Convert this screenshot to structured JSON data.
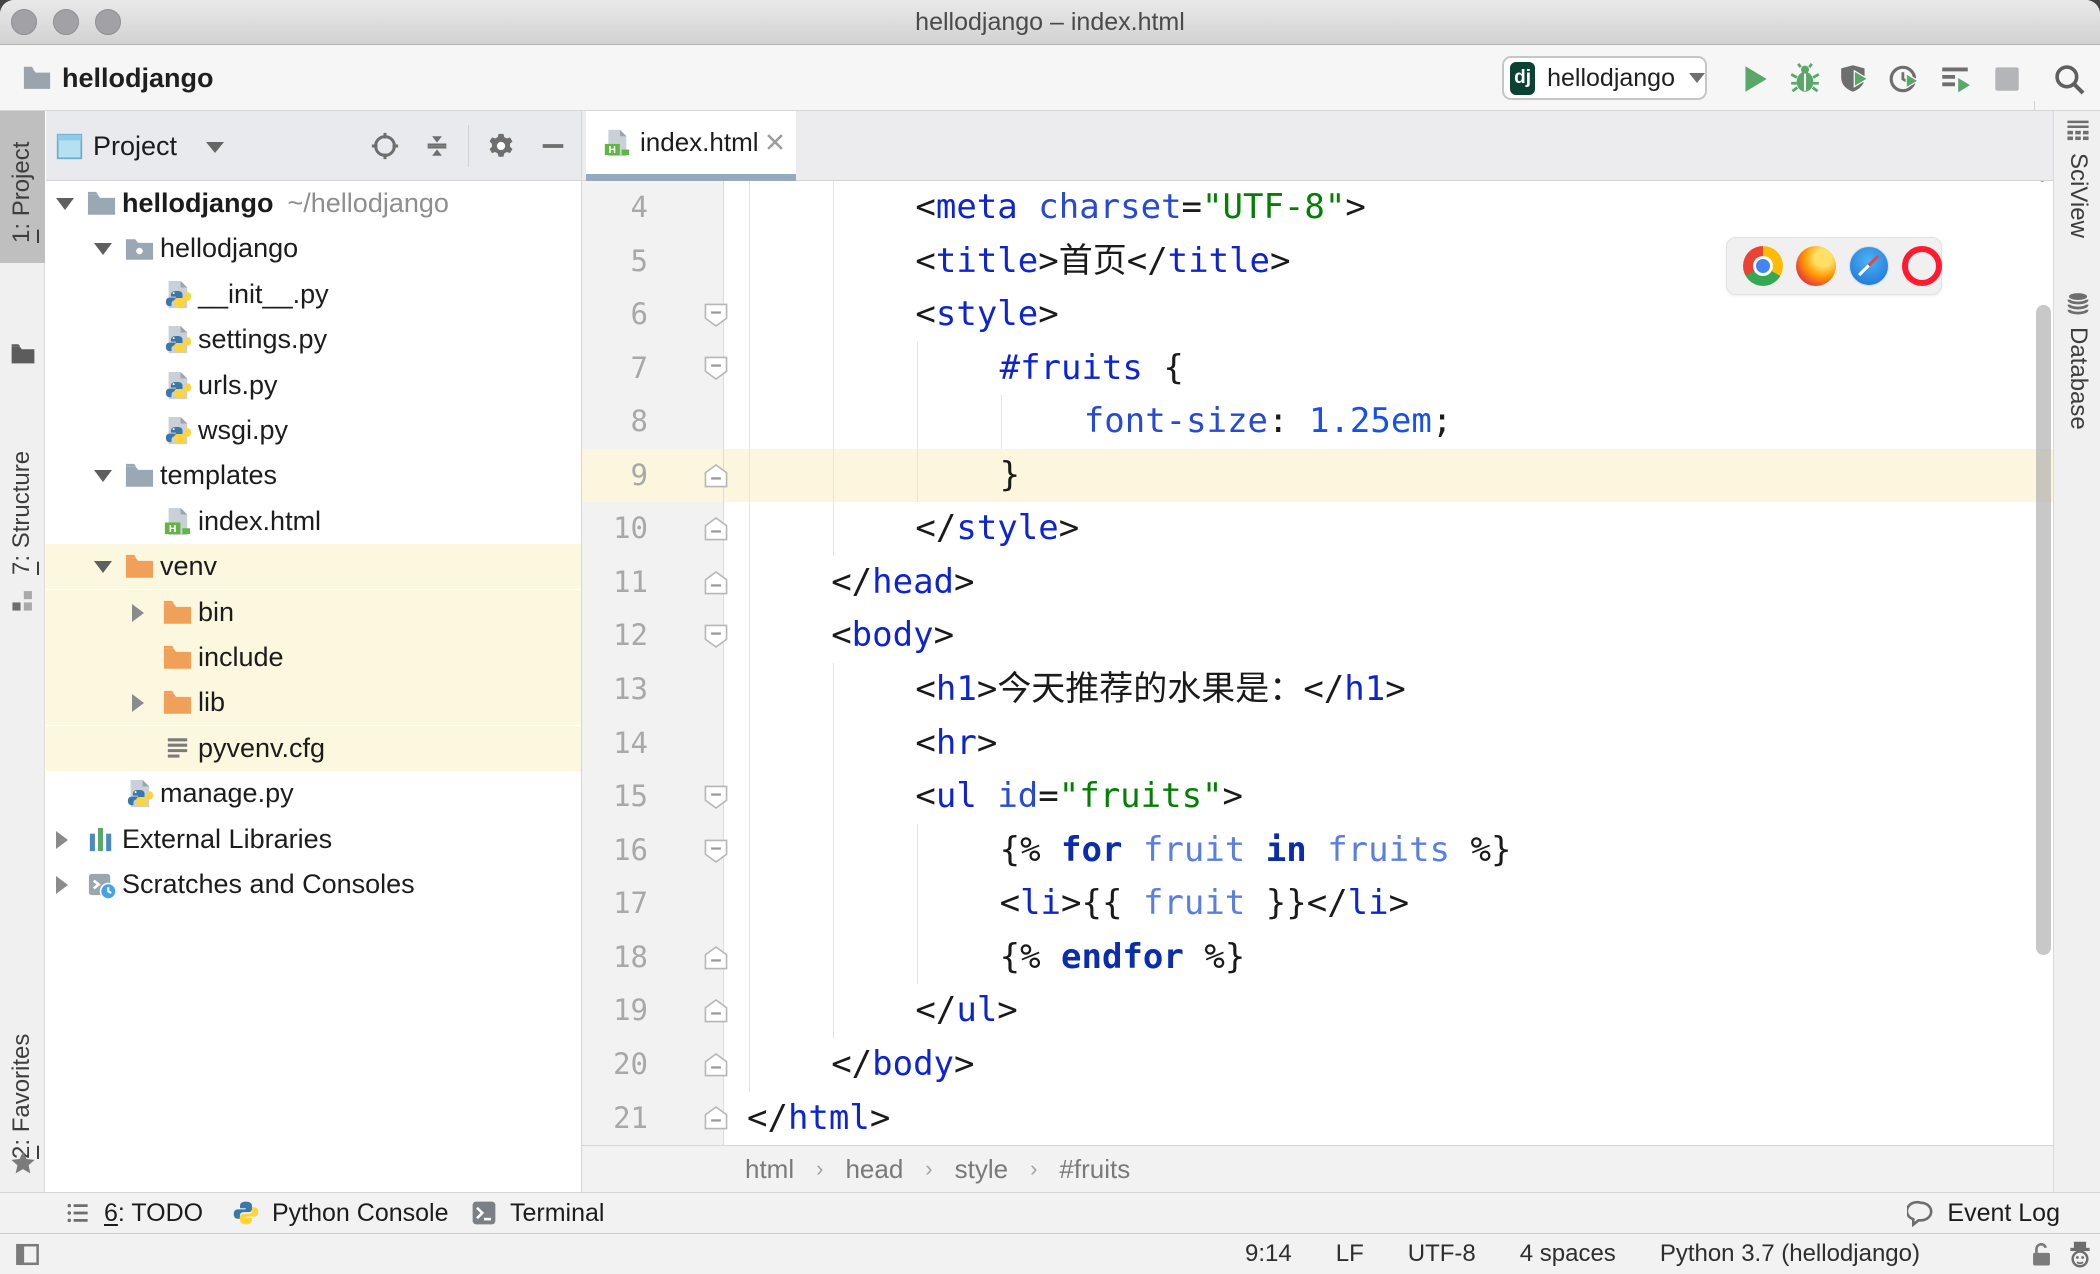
{
  "window": {
    "title": "hellodjango – index.html"
  },
  "navbar": {
    "crumb": "hellodjango",
    "run_config": {
      "badge": "dj",
      "name": "hellodjango"
    },
    "buttons": [
      "run",
      "debug",
      "run-coverage",
      "profile",
      "run-concurrency",
      "stop",
      "search"
    ]
  },
  "left_bar": {
    "items": [
      {
        "label": "1: Project",
        "icon": "project-folder",
        "active": true
      },
      {
        "label": "7: Structure",
        "icon": "structure"
      },
      {
        "label": "2: Favorites",
        "icon": "star"
      }
    ]
  },
  "right_bar": {
    "items": [
      {
        "label": "SciView",
        "icon": "sciview"
      },
      {
        "label": "Database",
        "icon": "database"
      }
    ]
  },
  "project_panel": {
    "title": "Project",
    "tree": [
      {
        "label": "hellodjango",
        "extra": "~/hellodjango",
        "level": 0,
        "arrow": "open",
        "icon": "folder",
        "bold": true
      },
      {
        "label": "hellodjango",
        "level": 1,
        "arrow": "open",
        "icon": "folder-pkg"
      },
      {
        "label": "__init__.py",
        "level": 2,
        "icon": "py"
      },
      {
        "label": "settings.py",
        "level": 2,
        "icon": "py"
      },
      {
        "label": "urls.py",
        "level": 2,
        "icon": "py"
      },
      {
        "label": "wsgi.py",
        "level": 2,
        "icon": "py"
      },
      {
        "label": "templates",
        "level": 1,
        "arrow": "open",
        "icon": "folder"
      },
      {
        "label": "index.html",
        "level": 2,
        "icon": "html"
      },
      {
        "label": "venv",
        "level": 1,
        "arrow": "open",
        "icon": "folder-x",
        "hl": true
      },
      {
        "label": "bin",
        "level": 2,
        "arrow": "closed",
        "icon": "folder-x",
        "hl": true
      },
      {
        "label": "include",
        "level": 2,
        "icon": "folder-x",
        "hl": true
      },
      {
        "label": "lib",
        "level": 2,
        "arrow": "closed",
        "icon": "folder-x",
        "hl": true
      },
      {
        "label": "pyvenv.cfg",
        "level": 2,
        "icon": "cfg",
        "hl": true
      },
      {
        "label": "manage.py",
        "level": 1,
        "icon": "py"
      },
      {
        "label": "External Libraries",
        "level": 0,
        "arrow": "closed",
        "icon": "libs"
      },
      {
        "label": "Scratches and Consoles",
        "level": 0,
        "arrow": "closed",
        "icon": "scratches"
      }
    ]
  },
  "editor": {
    "tab": {
      "label": "index.html"
    },
    "caret_line": 9,
    "browsers": [
      "chrome",
      "firefox",
      "safari",
      "opera"
    ],
    "breadcrumbs": [
      "html",
      "head",
      "style",
      "#fruits"
    ],
    "lines": [
      {
        "num": 4,
        "cols": 8,
        "fold": null,
        "seg": [
          [
            "p",
            "<"
          ],
          [
            "tag",
            "meta"
          ],
          [
            "t",
            " "
          ],
          [
            "attr",
            "charset"
          ],
          [
            "p",
            "="
          ],
          [
            "str",
            "\"UTF-8\""
          ],
          [
            "p",
            ">"
          ]
        ]
      },
      {
        "num": 5,
        "cols": 8,
        "fold": null,
        "seg": [
          [
            "p",
            "<"
          ],
          [
            "tag",
            "title"
          ],
          [
            "p",
            ">"
          ],
          [
            "t",
            "首页"
          ],
          [
            "p",
            "</"
          ],
          [
            "tag",
            "title"
          ],
          [
            "p",
            ">"
          ]
        ]
      },
      {
        "num": 6,
        "cols": 8,
        "fold": "start",
        "seg": [
          [
            "p",
            "<"
          ],
          [
            "tag",
            "style"
          ],
          [
            "p",
            ">"
          ]
        ]
      },
      {
        "num": 7,
        "cols": 12,
        "fold": "start",
        "seg": [
          [
            "sel",
            "#fruits"
          ],
          [
            "t",
            " {"
          ]
        ]
      },
      {
        "num": 8,
        "cols": 16,
        "fold": null,
        "seg": [
          [
            "attr",
            "font-size"
          ],
          [
            "t",
            ": "
          ],
          [
            "num",
            "1.25em"
          ],
          [
            "t",
            ";"
          ]
        ]
      },
      {
        "num": 9,
        "cols": 12,
        "fold": "end",
        "seg": [
          [
            "t",
            "}"
          ]
        ]
      },
      {
        "num": 10,
        "cols": 8,
        "fold": "end",
        "seg": [
          [
            "p",
            "</"
          ],
          [
            "tag",
            "style"
          ],
          [
            "p",
            ">"
          ]
        ]
      },
      {
        "num": 11,
        "cols": 4,
        "fold": "end",
        "seg": [
          [
            "p",
            "</"
          ],
          [
            "tag",
            "head"
          ],
          [
            "p",
            ">"
          ]
        ]
      },
      {
        "num": 12,
        "cols": 4,
        "fold": "start",
        "seg": [
          [
            "p",
            "<"
          ],
          [
            "tag",
            "body"
          ],
          [
            "p",
            ">"
          ]
        ]
      },
      {
        "num": 13,
        "cols": 8,
        "fold": null,
        "seg": [
          [
            "p",
            "<"
          ],
          [
            "tag",
            "h1"
          ],
          [
            "p",
            ">"
          ],
          [
            "t",
            "今天推荐的水果是："
          ],
          [
            "p",
            "</"
          ],
          [
            "tag",
            "h1"
          ],
          [
            "p",
            ">"
          ]
        ]
      },
      {
        "num": 14,
        "cols": 8,
        "fold": null,
        "seg": [
          [
            "p",
            "<"
          ],
          [
            "tag",
            "hr"
          ],
          [
            "p",
            ">"
          ]
        ]
      },
      {
        "num": 15,
        "cols": 8,
        "fold": "start",
        "seg": [
          [
            "p",
            "<"
          ],
          [
            "tag",
            "ul"
          ],
          [
            "t",
            " "
          ],
          [
            "attr",
            "id"
          ],
          [
            "p",
            "="
          ],
          [
            "str",
            "\"fruits\""
          ],
          [
            "p",
            ">"
          ]
        ]
      },
      {
        "num": 16,
        "cols": 12,
        "fold": "start",
        "seg": [
          [
            "t",
            "{% "
          ],
          [
            "kw",
            "for"
          ],
          [
            "t",
            " "
          ],
          [
            "var",
            "fruit"
          ],
          [
            "t",
            " "
          ],
          [
            "kw",
            "in"
          ],
          [
            "t",
            " "
          ],
          [
            "var",
            "fruits"
          ],
          [
            "t",
            " %}"
          ]
        ]
      },
      {
        "num": 17,
        "cols": 12,
        "fold": null,
        "seg": [
          [
            "p",
            "<"
          ],
          [
            "tag",
            "li"
          ],
          [
            "p",
            ">"
          ],
          [
            "t",
            "{{ "
          ],
          [
            "var",
            "fruit"
          ],
          [
            "t",
            " }}"
          ],
          [
            "p",
            "</"
          ],
          [
            "tag",
            "li"
          ],
          [
            "p",
            ">"
          ]
        ]
      },
      {
        "num": 18,
        "cols": 12,
        "fold": "end",
        "seg": [
          [
            "t",
            "{% "
          ],
          [
            "kw",
            "endfor"
          ],
          [
            "t",
            " %}"
          ]
        ]
      },
      {
        "num": 19,
        "cols": 8,
        "fold": "end",
        "seg": [
          [
            "p",
            "</"
          ],
          [
            "tag",
            "ul"
          ],
          [
            "p",
            ">"
          ]
        ]
      },
      {
        "num": 20,
        "cols": 4,
        "fold": "end",
        "seg": [
          [
            "p",
            "</"
          ],
          [
            "tag",
            "body"
          ],
          [
            "p",
            ">"
          ]
        ]
      },
      {
        "num": 21,
        "cols": 0,
        "fold": "end",
        "seg": [
          [
            "p",
            "</"
          ],
          [
            "tag",
            "html"
          ],
          [
            "p",
            ">"
          ]
        ]
      }
    ]
  },
  "bottom_bar": {
    "items": [
      {
        "label": "6: TODO",
        "icon": "todo",
        "mnemonic": true
      },
      {
        "label": "Python Console",
        "icon": "python"
      },
      {
        "label": "Terminal",
        "icon": "terminal"
      }
    ],
    "event_log": "Event Log"
  },
  "status_bar": {
    "items": [
      "9:14",
      "LF",
      "UTF-8",
      "4 spaces",
      "Python 3.7 (hellodjango)"
    ]
  },
  "colors": {
    "accent_green": "#59a869",
    "caret_line": "#fbf6dd",
    "excluded_highlight": "#fcf8df",
    "tab_underline": "#96a9bf",
    "run_badge_bg": "#0c4232"
  }
}
